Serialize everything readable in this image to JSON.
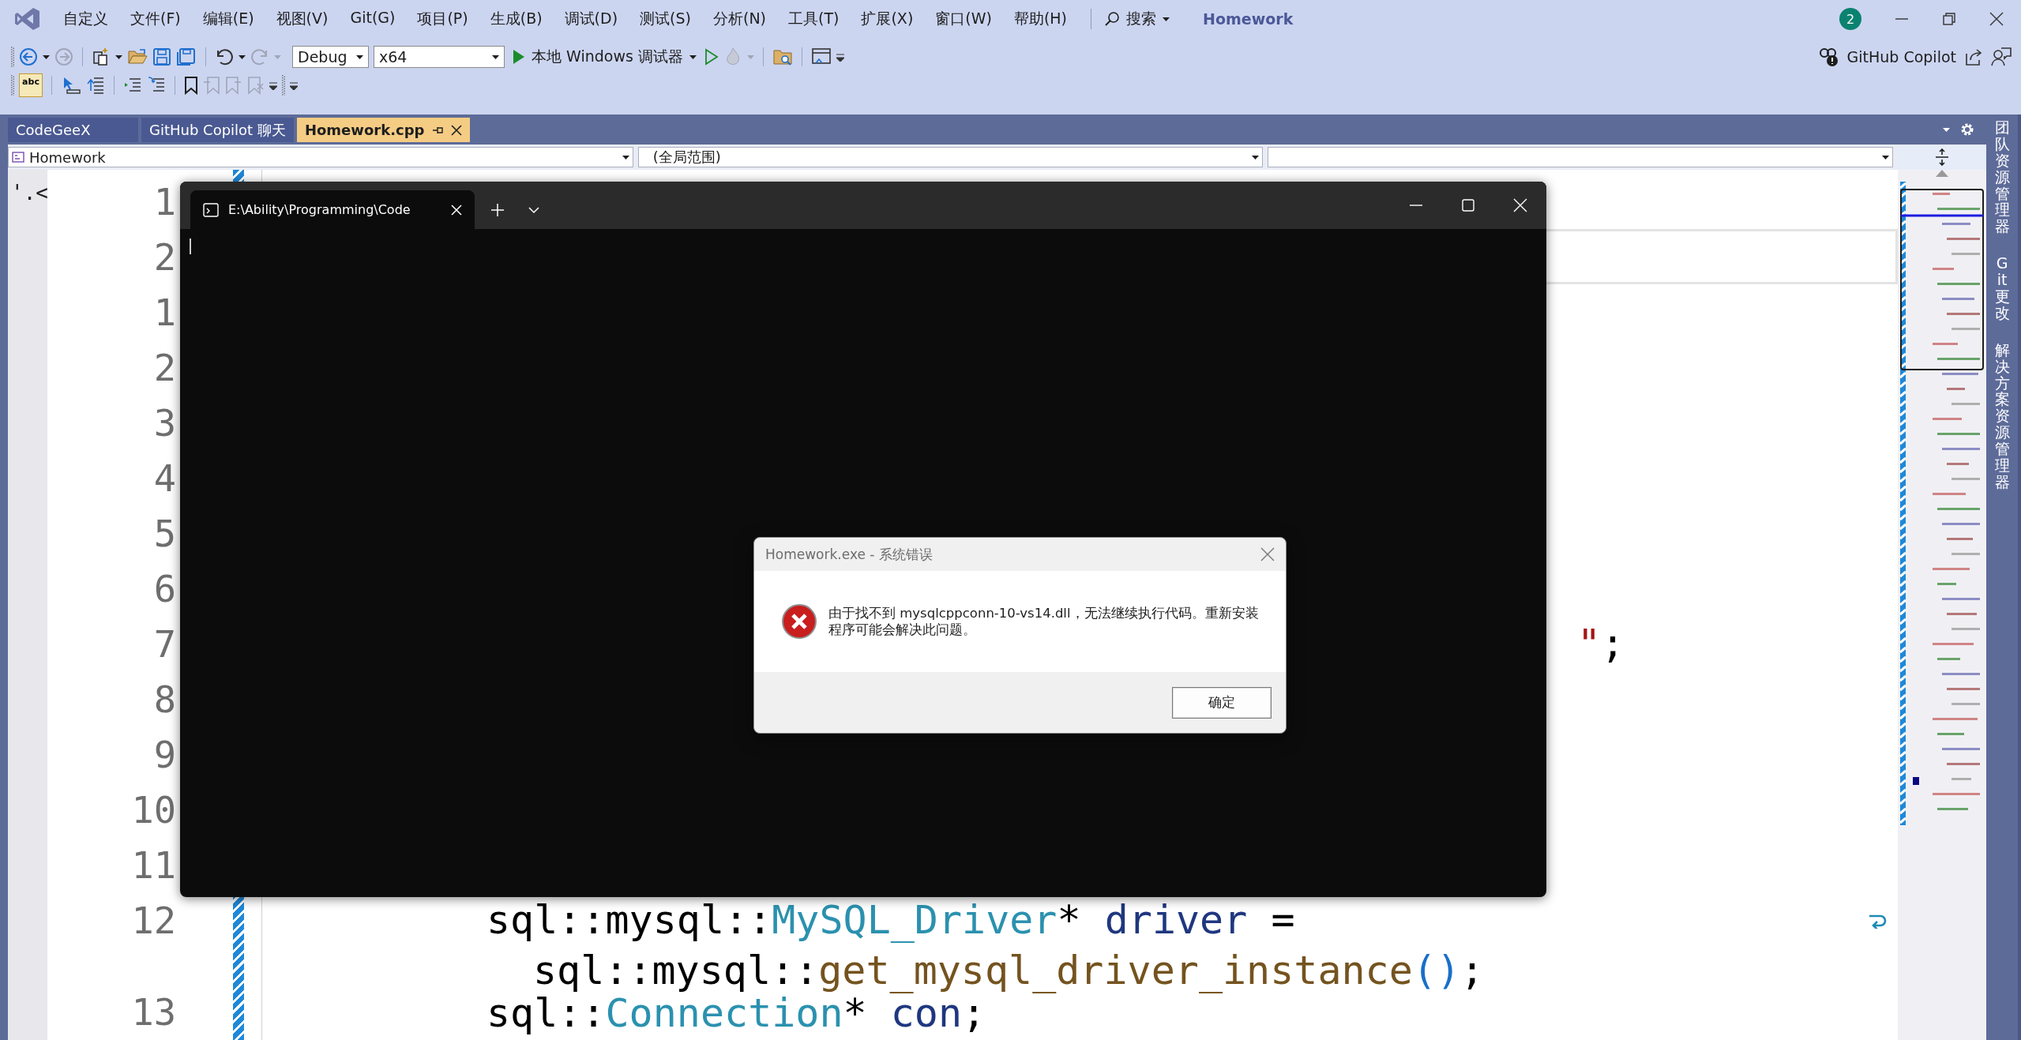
{
  "title_bar": {
    "menu": [
      "自定义",
      "文件(F)",
      "编辑(E)",
      "视图(V)",
      "Git(G)",
      "项目(P)",
      "生成(B)",
      "调试(D)",
      "测试(S)",
      "分析(N)",
      "工具(T)",
      "扩展(X)",
      "窗口(W)",
      "帮助(H)"
    ],
    "search": "搜索",
    "title": "Homework",
    "notification_count": "2"
  },
  "toolbar": {
    "configuration": "Debug",
    "platform": "x64",
    "run_label": "本地 Windows 调试器",
    "spell_check": "abc",
    "copilot": "GitHub Copilot"
  },
  "doc_tabs": [
    {
      "label": "CodeGeeX",
      "selected": false
    },
    {
      "label": "GitHub Copilot 聊天",
      "selected": false
    },
    {
      "label": "Homework.cpp",
      "selected": true
    }
  ],
  "nav_bar": {
    "project": "Homework",
    "scope": "(全局范围)"
  },
  "editor": {
    "fragment": "'.<",
    "lines": [
      {
        "number": "1",
        "current": false
      },
      {
        "number": "2",
        "current": true
      },
      {
        "number": "1",
        "current": false
      },
      {
        "number": "2",
        "current": false
      },
      {
        "number": "3",
        "current": false
      },
      {
        "number": "4",
        "current": false
      },
      {
        "number": "5",
        "current": false
      },
      {
        "number": "6",
        "current": false
      },
      {
        "number": "7",
        "current": false,
        "kind": "tail",
        "code": [
          {
            "t": "\"",
            "kind": "string"
          },
          {
            "t": ";",
            "kind": "plain"
          }
        ]
      },
      {
        "number": "8",
        "current": false
      },
      {
        "number": "9",
        "current": false
      },
      {
        "number": "10",
        "current": false
      },
      {
        "number": "11",
        "current": false
      },
      {
        "number": "12",
        "current": false,
        "kind": "stmt",
        "wrapped": true,
        "code": [
          {
            "t": "sql::mysql::",
            "kind": "plain"
          },
          {
            "t": "MySQL_Driver",
            "kind": "class"
          },
          {
            "t": "* ",
            "kind": "plain"
          },
          {
            "t": "driver",
            "kind": "var"
          },
          {
            "t": " =",
            "kind": "plain"
          }
        ]
      },
      {
        "current": false,
        "kind": "cont",
        "code": [
          {
            "t": "sql::mysql::",
            "kind": "plain"
          },
          {
            "t": "get_mysql_driver_instance",
            "kind": "func"
          },
          {
            "t": "()",
            "kind": "paren"
          },
          {
            "t": ";",
            "kind": "plain"
          }
        ]
      },
      {
        "number": "13",
        "current": false,
        "kind": "stmt",
        "code": [
          {
            "t": "sql::",
            "kind": "plain"
          },
          {
            "t": "Connection",
            "kind": "class"
          },
          {
            "t": "* ",
            "kind": "plain"
          },
          {
            "t": "con",
            "kind": "var"
          },
          {
            "t": ";",
            "kind": "plain"
          }
        ]
      }
    ]
  },
  "side_tabs": [
    "团队资源管理器",
    "Git 更改",
    "解决方案资源管理器"
  ],
  "terminal": {
    "tab_title": "E:\\Ability\\Programming\\Code"
  },
  "dialog": {
    "title": "Homework.exe - 系统错误",
    "message": "由于找不到 mysqlcppconn-10-vs14.dll，无法继续执行代码。重新安装程序可能会解决此问题。",
    "button": "确定"
  }
}
